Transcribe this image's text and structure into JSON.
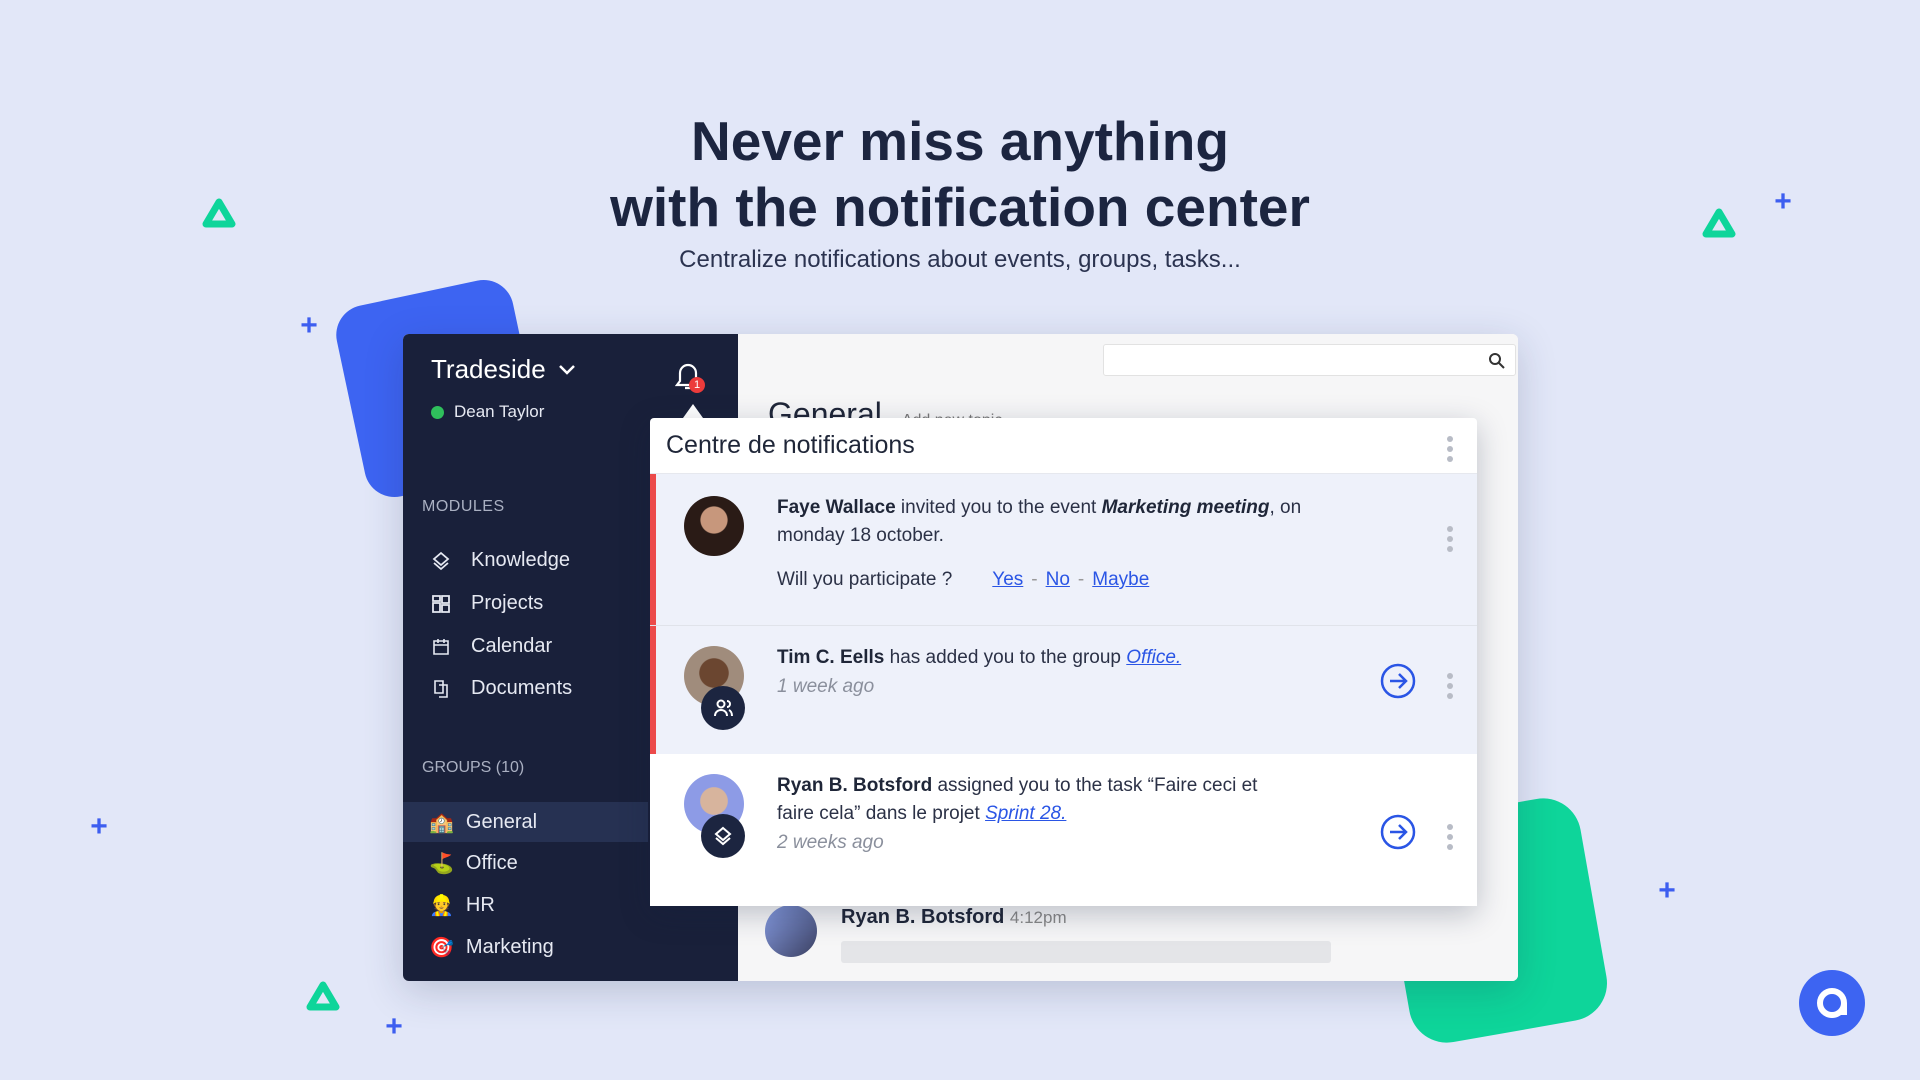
{
  "hero": {
    "title_line1": "Never miss anything",
    "title_line2": "with the notification center",
    "subtitle": "Centralize notifications about events, groups, tasks..."
  },
  "colors": {
    "background": "#e2e7f8",
    "sidebar": "#19203a",
    "accent_blue": "#2a55e5",
    "accent_green": "#0ed59a",
    "unread_bar": "#ec4a4a"
  },
  "sidebar": {
    "workspace": "Tradeside",
    "user": "Dean Taylor",
    "status": "online",
    "notification_count": "1",
    "modules_label": "MODULES",
    "modules": [
      {
        "label": "Knowledge",
        "icon": "layers-icon"
      },
      {
        "label": "Projects",
        "icon": "grid-icon"
      },
      {
        "label": "Calendar",
        "icon": "calendar-icon"
      },
      {
        "label": "Documents",
        "icon": "documents-icon"
      }
    ],
    "groups_label": "GROUPS (10)",
    "groups": [
      {
        "label": "General",
        "emoji": "🏫",
        "active": true
      },
      {
        "label": "Office",
        "emoji": "⛳"
      },
      {
        "label": "HR",
        "emoji": "👷"
      },
      {
        "label": "Marketing",
        "emoji": "🎯"
      }
    ]
  },
  "main": {
    "channel": "General",
    "add_topic": "Add new topic",
    "message": {
      "author": "Ryan B. Botsford",
      "time": "4:12pm"
    }
  },
  "notifications": {
    "title": "Centre de notifications",
    "items": [
      {
        "actor": "Faye Wallace",
        "text1": " invited you to the event ",
        "event": "Marketing meeting",
        "text2": ", on monday 18 october.",
        "question": "Will you participate ?",
        "yes": "Yes",
        "no": "No",
        "maybe": "Maybe",
        "sep": "-",
        "unread": true
      },
      {
        "actor": "Tim C. Eells",
        "text1": " has added you to the group ",
        "link": "Office.",
        "time": "1 week ago",
        "unread": true
      },
      {
        "actor": "Ryan B. Botsford",
        "text1": " assigned you to the task “Faire ceci et faire cela” dans le projet ",
        "link": "Sprint 28.",
        "time": "2 weeks ago",
        "unread": false
      }
    ]
  }
}
